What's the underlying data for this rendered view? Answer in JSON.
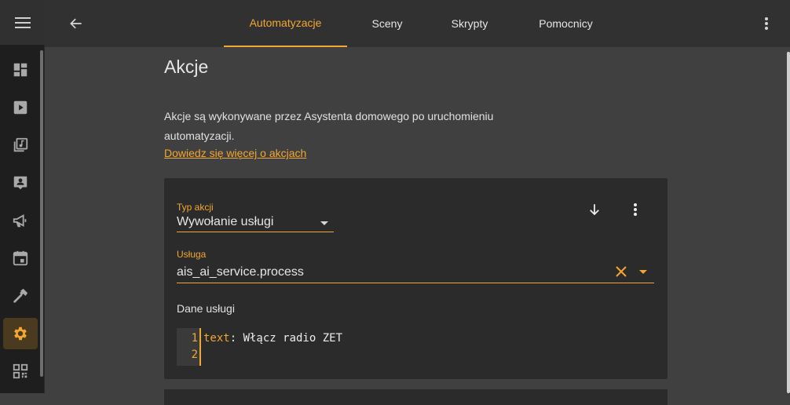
{
  "nav": {
    "tabs": [
      {
        "label": "Automatyzacje",
        "active": true
      },
      {
        "label": "Sceny",
        "active": false
      },
      {
        "label": "Skrypty",
        "active": false
      },
      {
        "label": "Pomocnicy",
        "active": false
      }
    ]
  },
  "sidebar": {
    "items": [
      {
        "icon": "dashboard-icon"
      },
      {
        "icon": "media-player-icon"
      },
      {
        "icon": "music-library-icon"
      },
      {
        "icon": "account-box-icon"
      },
      {
        "icon": "megaphone-icon"
      },
      {
        "icon": "calendar-icon"
      },
      {
        "icon": "hammer-icon"
      },
      {
        "icon": "gear-icon",
        "active": true
      },
      {
        "icon": "qr-code-icon"
      }
    ]
  },
  "section": {
    "title": "Akcje",
    "description": "Akcje są wykonywane przez Asystenta domowego po uruchomieniu automatyzacji.",
    "learn_more": "Dowiedz się więcej o akcjach"
  },
  "action": {
    "type_label": "Typ akcji",
    "type_value": "Wywołanie usługi",
    "service_label": "Usługa",
    "service_value": "ais_ai_service.process",
    "data_label": "Dane usługi",
    "code_lines": [
      {
        "num": "1",
        "key": "text",
        "value": ": Włącz radio ZET"
      },
      {
        "num": "2",
        "key": "",
        "value": ""
      }
    ]
  },
  "colors": {
    "accent": "#f3a632",
    "background": "#404040",
    "card": "#2b2b2b",
    "topbar": "#313131"
  }
}
